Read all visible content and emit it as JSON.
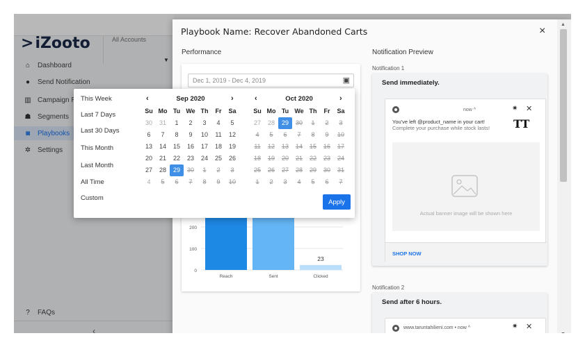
{
  "app": {
    "logo": "iZooto",
    "account_selector": "All Accounts",
    "sidebar": [
      {
        "label": "Dashboard",
        "icon": "home-icon"
      },
      {
        "label": "Send Notification",
        "icon": "bell-icon"
      },
      {
        "label": "Campaign Rep",
        "icon": "bar-chart-icon"
      },
      {
        "label": "Segments",
        "icon": "users-icon"
      },
      {
        "label": "Playbooks",
        "icon": "playbook-icon"
      },
      {
        "label": "Settings",
        "icon": "gear-icon"
      }
    ],
    "faqs": "FAQs",
    "collapse": "‹"
  },
  "modal": {
    "title": "Playbook Name: Recover Abandoned Carts",
    "close": "×",
    "performance_label": "Performance",
    "date_range": "Dec 1, 2019 - Dec 4, 2019",
    "preview_label": "Notification Preview"
  },
  "picker": {
    "presets": [
      "This Week",
      "Last 7 Days",
      "Last 30 Days",
      "This Month",
      "Last Month",
      "All Time",
      "Custom"
    ],
    "apply": "Apply",
    "weekdays": [
      "Su",
      "Mo",
      "Tu",
      "We",
      "Th",
      "Fr",
      "Sa"
    ],
    "months": [
      {
        "title": "Sep 2020",
        "days": [
          [
            "30",
            "m"
          ],
          [
            "31",
            "m"
          ],
          [
            "1",
            ""
          ],
          [
            "2",
            ""
          ],
          [
            "3",
            ""
          ],
          [
            "4",
            ""
          ],
          [
            "5",
            ""
          ],
          [
            "6",
            ""
          ],
          [
            "7",
            ""
          ],
          [
            "8",
            ""
          ],
          [
            "9",
            ""
          ],
          [
            "10",
            ""
          ],
          [
            "11",
            ""
          ],
          [
            "12",
            ""
          ],
          [
            "13",
            ""
          ],
          [
            "14",
            ""
          ],
          [
            "15",
            ""
          ],
          [
            "16",
            ""
          ],
          [
            "17",
            ""
          ],
          [
            "18",
            ""
          ],
          [
            "19",
            ""
          ],
          [
            "20",
            ""
          ],
          [
            "21",
            ""
          ],
          [
            "22",
            ""
          ],
          [
            "23",
            ""
          ],
          [
            "24",
            ""
          ],
          [
            "25",
            ""
          ],
          [
            "26",
            ""
          ],
          [
            "27",
            ""
          ],
          [
            "28",
            ""
          ],
          [
            "29",
            "sel"
          ],
          [
            "30",
            "s"
          ],
          [
            "1",
            "s"
          ],
          [
            "2",
            "s"
          ],
          [
            "3",
            "s"
          ],
          [
            "4",
            "m"
          ],
          [
            "5",
            "s"
          ],
          [
            "6",
            "s"
          ],
          [
            "7",
            "s"
          ],
          [
            "8",
            "s"
          ],
          [
            "9",
            "s"
          ],
          [
            "10",
            "s"
          ]
        ]
      },
      {
        "title": "Oct 2020",
        "days": [
          [
            "27",
            "m"
          ],
          [
            "28",
            "m"
          ],
          [
            "29",
            "sel"
          ],
          [
            "30",
            "s"
          ],
          [
            "1",
            "s"
          ],
          [
            "2",
            "s"
          ],
          [
            "3",
            "s"
          ],
          [
            "4",
            "s"
          ],
          [
            "5",
            "s"
          ],
          [
            "6",
            "s"
          ],
          [
            "7",
            "s"
          ],
          [
            "8",
            "s"
          ],
          [
            "9",
            "s"
          ],
          [
            "10",
            "s"
          ],
          [
            "11",
            "s"
          ],
          [
            "12",
            "s"
          ],
          [
            "13",
            "s"
          ],
          [
            "14",
            "s"
          ],
          [
            "15",
            "s"
          ],
          [
            "16",
            "s"
          ],
          [
            "17",
            "s"
          ],
          [
            "18",
            "s"
          ],
          [
            "19",
            "s"
          ],
          [
            "20",
            "s"
          ],
          [
            "21",
            "s"
          ],
          [
            "22",
            "s"
          ],
          [
            "23",
            "s"
          ],
          [
            "24",
            "s"
          ],
          [
            "25",
            "s"
          ],
          [
            "26",
            "s"
          ],
          [
            "27",
            "s"
          ],
          [
            "28",
            "s"
          ],
          [
            "29",
            "s"
          ],
          [
            "30",
            "s"
          ],
          [
            "31",
            "s"
          ],
          [
            "1",
            "s"
          ],
          [
            "2",
            "s"
          ],
          [
            "3",
            "s"
          ],
          [
            "4",
            "s"
          ],
          [
            "5",
            "s"
          ],
          [
            "6",
            "s"
          ],
          [
            "7",
            "s"
          ]
        ]
      }
    ]
  },
  "chart_data": {
    "type": "bar",
    "categories": [
      "Reach",
      "Sent",
      "Clicked"
    ],
    "values": [
      310,
      310,
      23
    ],
    "data_labels": [
      "",
      "",
      "23"
    ],
    "y_ticks": [
      "0",
      "100",
      "200"
    ],
    "ylim": [
      0,
      320
    ],
    "colors": [
      "#1e88e5",
      "#64b5f6",
      "#bbdefb"
    ]
  },
  "notifications": [
    {
      "label": "Notification 1",
      "timing": "Send immediately.",
      "time": "now ^",
      "line1": "You've left @product_name in your cart!",
      "line2": "Complete your purchase while stock lasts!",
      "brand": "TT",
      "banner_text": "Actual banner image will be shown here",
      "cta": "SHOP NOW"
    },
    {
      "label": "Notification 2",
      "timing": "Send after 6 hours.",
      "url_time": "www.taruntahilieni.com • now ^"
    }
  ]
}
